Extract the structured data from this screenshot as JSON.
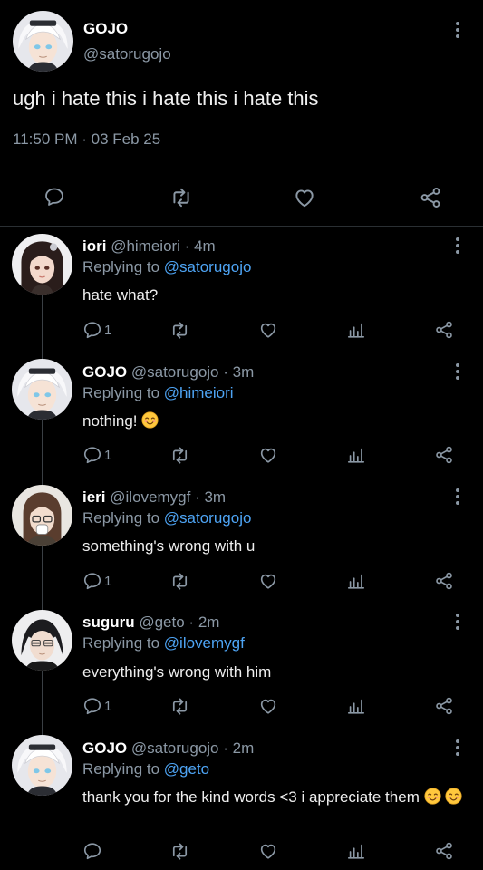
{
  "main_tweet": {
    "name": "GOJO",
    "handle": "@satorugojo",
    "text": "ugh i hate this i hate this i hate this",
    "time": "11:50 PM",
    "separator": " · ",
    "date": "03 Feb 25"
  },
  "labels": {
    "replying_to": "Replying to ",
    "dot": " · "
  },
  "replies": [
    {
      "name": "iori",
      "handle": "@himeiori",
      "age": "4m",
      "replying_to": "@satorugojo",
      "text": "hate what?",
      "reply_count": "1",
      "avatar": "dark-hair-avatar"
    },
    {
      "name": "GOJO",
      "handle": "@satorugojo",
      "age": "3m",
      "replying_to": "@himeiori",
      "text": "nothing!",
      "reply_count": "1",
      "avatar": "white-hair-avatar"
    },
    {
      "name": "ieri",
      "handle": "@ilovemygf",
      "age": "3m",
      "replying_to": "@satorugojo",
      "text": "something's wrong with u",
      "reply_count": "1",
      "avatar": "brown-hair-avatar"
    },
    {
      "name": "suguru",
      "handle": "@geto",
      "age": "2m",
      "replying_to": "@ilovemygf",
      "text": "everything's wrong with him",
      "reply_count": "1",
      "avatar": "black-hair-avatar"
    },
    {
      "name": "GOJO",
      "handle": "@satorugojo",
      "age": "2m",
      "replying_to": "@geto",
      "text": "thank you for the kind words <3 i appreciate them",
      "reply_count": "",
      "avatar": "white-hair-avatar"
    }
  ],
  "colors": {
    "background": "#000000",
    "muted": "#8b98a5",
    "mention": "#4ea4f4",
    "divider": "#2a2f33"
  },
  "icons": [
    "comment-icon",
    "retweet-icon",
    "like-icon",
    "share-icon",
    "stats-icon",
    "more-icon",
    "smiling-face-emoji"
  ]
}
